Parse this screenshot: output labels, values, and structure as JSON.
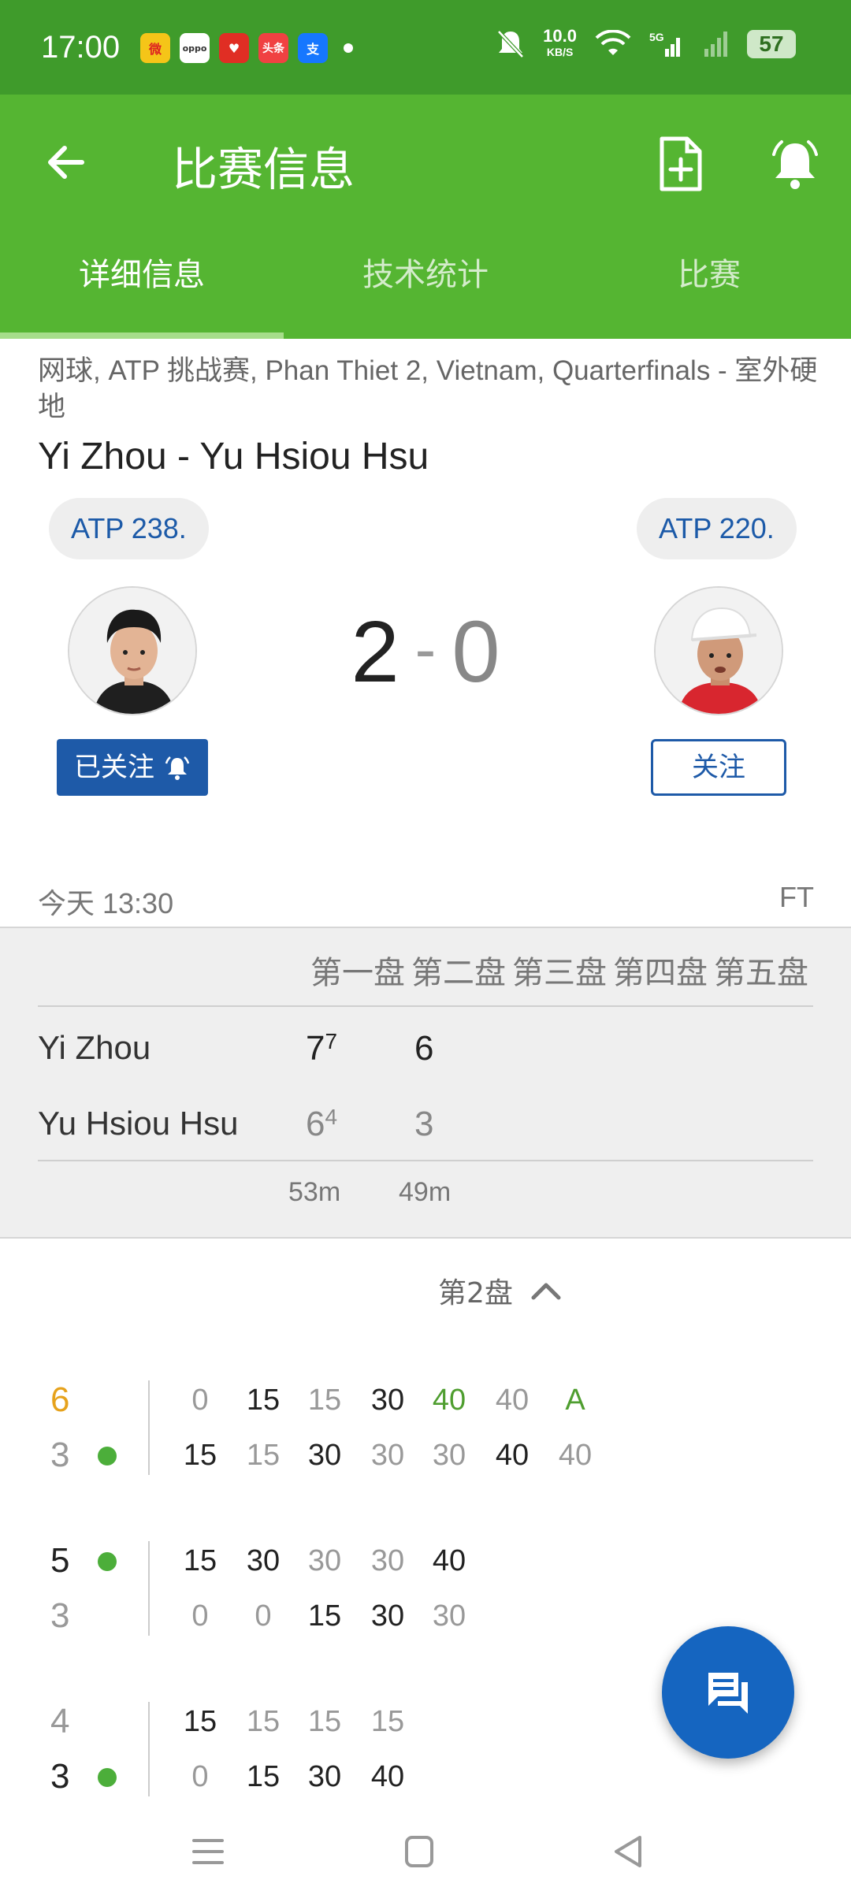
{
  "status_bar": {
    "time": "17:00",
    "net_speed": "10.0",
    "net_unit": "KB/S",
    "battery": "57",
    "apps": [
      "weibo",
      "oppo",
      "pinduoduo",
      "头条",
      "支"
    ]
  },
  "header": {
    "title": "比赛信息"
  },
  "tabs": [
    {
      "label": "详细信息",
      "active": true
    },
    {
      "label": "技术统计",
      "active": false
    },
    {
      "label": "比赛",
      "active": false
    }
  ],
  "match": {
    "breadcrumb": "网球, ATP 挑战赛, Phan Thiet 2, Vietnam, Quarterfinals - 室外硬地",
    "title": "Yi Zhou - Yu Hsiou Hsu",
    "home_rank": "ATP 238.",
    "away_rank": "ATP 220.",
    "home_sets": "2",
    "separator": "-",
    "away_sets": "0",
    "home_follow_label": "已关注",
    "away_follow_label": "关注",
    "date": "今天 13:30",
    "status": "FT"
  },
  "score_table": {
    "set_headers": [
      "第一盘",
      "第二盘",
      "第三盘",
      "第四盘",
      "第五盘"
    ],
    "home_name": "Yi Zhou",
    "away_name": "Yu Hsiou Hsu",
    "home_set1": "7",
    "home_set1_tb": "7",
    "home_set2": "6",
    "away_set1": "6",
    "away_set1_tb": "4",
    "away_set2": "3",
    "durations": [
      "53m",
      "49m"
    ]
  },
  "set_selector": {
    "label": "第2盘"
  },
  "games": [
    {
      "home_games": "6",
      "away_games": "3",
      "home_points": [
        "0",
        "15",
        "15",
        "30",
        "40",
        "40",
        "A"
      ],
      "away_points": [
        "15",
        "15",
        "30",
        "30",
        "30",
        "40",
        "40"
      ]
    },
    {
      "home_games": "5",
      "away_games": "3",
      "home_points": [
        "15",
        "30",
        "30",
        "30",
        "40"
      ],
      "away_points": [
        "0",
        "0",
        "15",
        "30",
        "30"
      ]
    },
    {
      "home_games": "4",
      "away_games": "3",
      "home_points": [
        "15",
        "15",
        "15",
        "15"
      ],
      "away_points": [
        "0",
        "15",
        "30",
        "40"
      ]
    }
  ],
  "colors": {
    "status_bar": "#3f9b2b",
    "app_bar": "#55b532",
    "primary_blue": "#1565c0",
    "serve_dot": "#4cae3a",
    "set_winner": "#e6a21c"
  },
  "icons": {
    "back": "arrow-left-icon",
    "add_doc": "add-document-icon",
    "bell": "bell-icon",
    "fab": "chat-icon"
  }
}
